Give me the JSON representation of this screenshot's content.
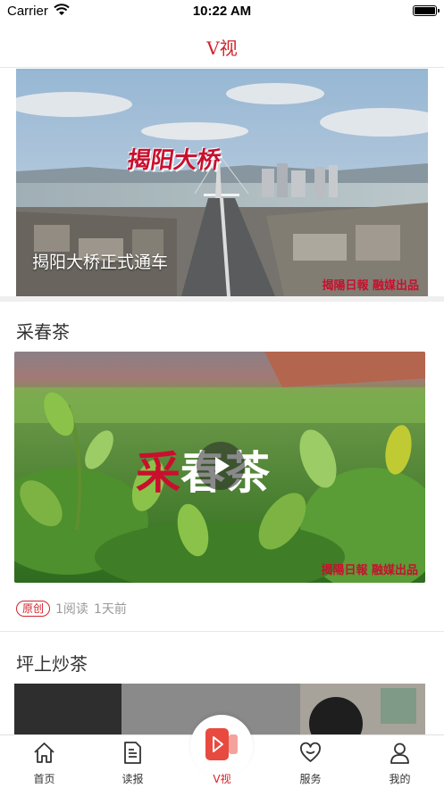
{
  "status_bar": {
    "carrier": "Carrier",
    "time": "10:22 AM"
  },
  "nav": {
    "title": "V视"
  },
  "hero": {
    "caption": "揭阳大桥正式通车",
    "title_overlay": "揭阳大桥",
    "watermark": "揭陽日報 融媒出品"
  },
  "articles": [
    {
      "title": "采春茶",
      "art_title_red": "采",
      "art_title_white": "春茶",
      "watermark": "揭陽日報 融媒出品",
      "badge": "原创",
      "reads": "1阅读",
      "time": "1天前"
    },
    {
      "title": "坪上炒茶"
    }
  ],
  "tabbar": {
    "items": [
      {
        "label": "首页",
        "icon": "home-icon"
      },
      {
        "label": "读报",
        "icon": "newspaper-icon"
      },
      {
        "label": "V视",
        "icon": "video-play-icon"
      },
      {
        "label": "服务",
        "icon": "heart-service-icon"
      },
      {
        "label": "我的",
        "icon": "user-icon"
      }
    ],
    "active_index": 2
  },
  "colors": {
    "accent": "#d2232a"
  }
}
